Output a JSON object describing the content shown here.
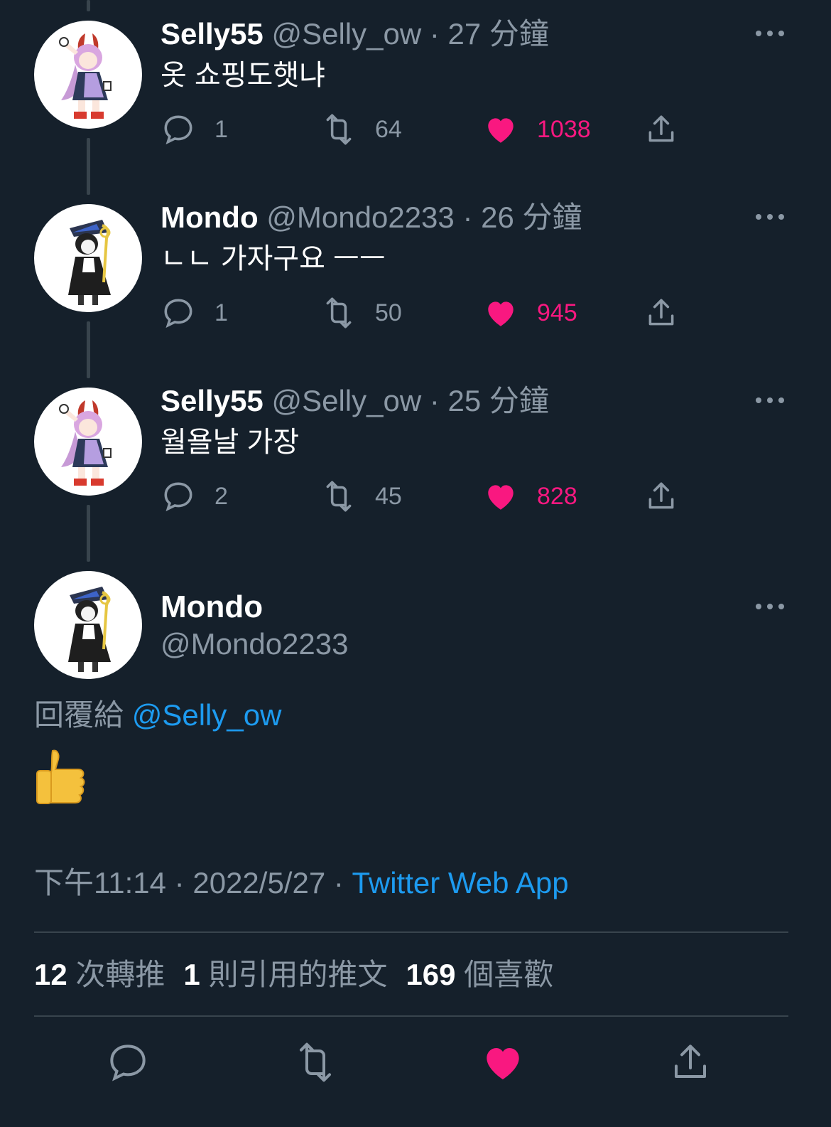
{
  "thread": [
    {
      "name": "Selly55",
      "handle": "@Selly_ow",
      "separator": "·",
      "time": "27 分鐘",
      "text": "옷 쇼핑도햇냐",
      "avatar_icon": "pink-hair-character-avatar",
      "reply_count": "1",
      "retweet_count": "64",
      "like_count": "1038"
    },
    {
      "name": "Mondo",
      "handle": "@Mondo2233",
      "separator": "·",
      "time": "26 分鐘",
      "text": "ㄴㄴ 가자구요 ㅡㅡ",
      "avatar_icon": "dark-coat-character-avatar",
      "reply_count": "1",
      "retweet_count": "50",
      "like_count": "945"
    },
    {
      "name": "Selly55",
      "handle": "@Selly_ow",
      "separator": "·",
      "time": "25 分鐘",
      "text": "월욜날 가장",
      "avatar_icon": "pink-hair-character-avatar",
      "reply_count": "2",
      "retweet_count": "45",
      "like_count": "828"
    }
  ],
  "main_tweet": {
    "name": "Mondo",
    "handle": "@Mondo2233",
    "reply_prefix": "回覆給",
    "reply_mention": "@Selly_ow",
    "emoji": "thumbs-up-emoji",
    "time": "下午11:14",
    "separator": "·",
    "date": "2022/5/27",
    "source": "Twitter Web App",
    "retweets_num": "12",
    "retweets_label": "次轉推",
    "quotes_num": "1",
    "quotes_label": "則引用的推文",
    "likes_num": "169",
    "likes_label": "個喜歡"
  },
  "colors": {
    "background": "#15202b",
    "secondary_text": "#8b98a5",
    "like_pink": "#f91880",
    "link_blue": "#1d9bf0",
    "divider": "#38444d"
  }
}
